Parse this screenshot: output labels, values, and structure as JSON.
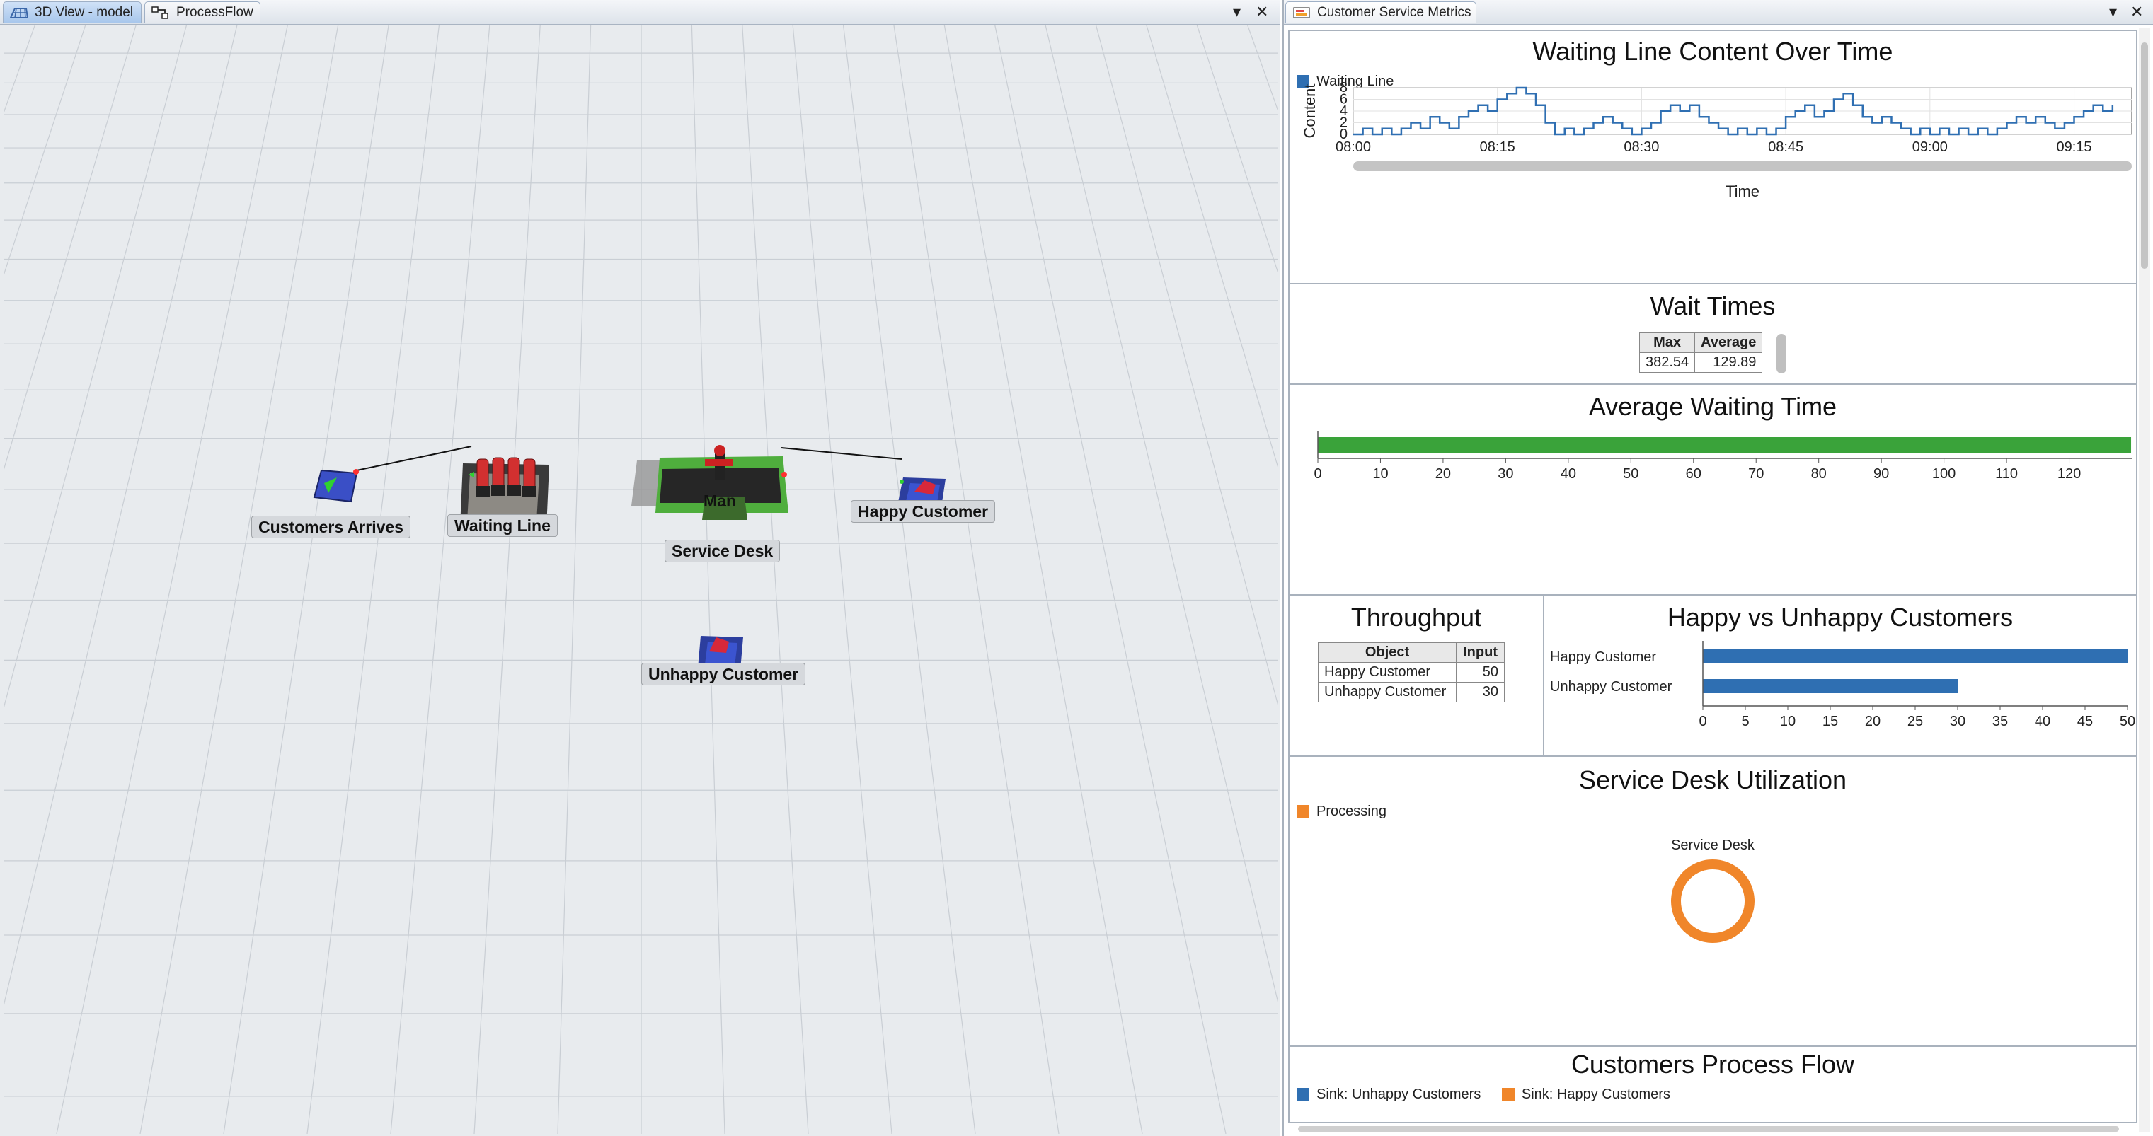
{
  "left_tabs": [
    {
      "label": "3D View - model",
      "active": true
    },
    {
      "label": "ProcessFlow",
      "active": false
    }
  ],
  "left_controls": {
    "menu": "▾",
    "close": "✕"
  },
  "model_objects": {
    "source": "Customers Arrives",
    "queue": "Waiting Line",
    "processor": "Service Desk",
    "operator": "Man",
    "sink_happy": "Happy Customer",
    "sink_unhappy": "Unhappy Customer"
  },
  "right_tab": {
    "label": "Customer Service Metrics"
  },
  "right_controls": {
    "menu": "▾",
    "close": "✕"
  },
  "colors": {
    "blue": "#2f6fb2",
    "green": "#3aa33a",
    "orange": "#f0862a"
  },
  "dashboard": {
    "waiting_line": {
      "title": "Waiting Line Content Over Time",
      "legend": "Waiting Line",
      "ylabel": "Content",
      "xlabel": "Time",
      "x_ticks": [
        "08:00",
        "08:15",
        "08:30",
        "08:45",
        "09:00",
        "09:15"
      ],
      "y_ticks": [
        "0",
        "2",
        "4",
        "6",
        "8"
      ]
    },
    "wait_times": {
      "title": "Wait Times",
      "headers": [
        "Max",
        "Average"
      ],
      "values": [
        "382.54",
        "129.89"
      ]
    },
    "avg_wait": {
      "title": "Average Waiting Time",
      "x_ticks": [
        "0",
        "10",
        "20",
        "30",
        "40",
        "50",
        "60",
        "70",
        "80",
        "90",
        "100",
        "110",
        "120"
      ]
    },
    "throughput": {
      "title": "Throughput",
      "headers": [
        "Object",
        "Input"
      ],
      "rows": [
        [
          "Happy Customer",
          "50"
        ],
        [
          "Unhappy Customer",
          "30"
        ]
      ]
    },
    "happy_unhappy": {
      "title": "Happy vs Unhappy Customers",
      "categories": [
        "Happy Customer",
        "Unhappy Customer"
      ],
      "x_ticks": [
        "0",
        "5",
        "10",
        "15",
        "20",
        "25",
        "30",
        "35",
        "40",
        "45",
        "50"
      ]
    },
    "utilization": {
      "title": "Service Desk Utilization",
      "legend": "Processing",
      "label": "Service Desk"
    },
    "process_flow": {
      "title": "Customers Process Flow",
      "legend": [
        "Sink: Unhappy Customers",
        "Sink: Happy Customers"
      ]
    }
  },
  "chart_data": [
    {
      "type": "line",
      "title": "Waiting Line Content Over Time",
      "xlabel": "Time",
      "ylabel": "Content",
      "ylim": [
        0,
        8
      ],
      "x_range": [
        "08:00",
        "09:19"
      ],
      "series": [
        {
          "name": "Waiting Line",
          "color": "#2f6fb2",
          "points": [
            [
              "08:00",
              0
            ],
            [
              "08:01",
              1
            ],
            [
              "08:02",
              0
            ],
            [
              "08:03",
              1
            ],
            [
              "08:04",
              0
            ],
            [
              "08:05",
              1
            ],
            [
              "08:06",
              2
            ],
            [
              "08:07",
              1
            ],
            [
              "08:08",
              3
            ],
            [
              "08:09",
              2
            ],
            [
              "08:10",
              1
            ],
            [
              "08:11",
              3
            ],
            [
              "08:12",
              4
            ],
            [
              "08:13",
              5
            ],
            [
              "08:14",
              4
            ],
            [
              "08:15",
              6
            ],
            [
              "08:16",
              7
            ],
            [
              "08:17",
              8
            ],
            [
              "08:18",
              7
            ],
            [
              "08:19",
              5
            ],
            [
              "08:20",
              2
            ],
            [
              "08:21",
              0
            ],
            [
              "08:22",
              1
            ],
            [
              "08:23",
              0
            ],
            [
              "08:24",
              1
            ],
            [
              "08:25",
              2
            ],
            [
              "08:26",
              3
            ],
            [
              "08:27",
              2
            ],
            [
              "08:28",
              1
            ],
            [
              "08:29",
              0
            ],
            [
              "08:30",
              1
            ],
            [
              "08:31",
              2
            ],
            [
              "08:32",
              4
            ],
            [
              "08:33",
              5
            ],
            [
              "08:34",
              4
            ],
            [
              "08:35",
              5
            ],
            [
              "08:36",
              3
            ],
            [
              "08:37",
              2
            ],
            [
              "08:38",
              1
            ],
            [
              "08:39",
              0
            ],
            [
              "08:40",
              1
            ],
            [
              "08:41",
              0
            ],
            [
              "08:42",
              1
            ],
            [
              "08:43",
              0
            ],
            [
              "08:44",
              1
            ],
            [
              "08:45",
              3
            ],
            [
              "08:46",
              4
            ],
            [
              "08:47",
              5
            ],
            [
              "08:48",
              3
            ],
            [
              "08:49",
              4
            ],
            [
              "08:50",
              6
            ],
            [
              "08:51",
              7
            ],
            [
              "08:52",
              5
            ],
            [
              "08:53",
              3
            ],
            [
              "08:54",
              2
            ],
            [
              "08:55",
              3
            ],
            [
              "08:56",
              2
            ],
            [
              "08:57",
              1
            ],
            [
              "08:58",
              0
            ],
            [
              "08:59",
              1
            ],
            [
              "09:00",
              0
            ],
            [
              "09:01",
              1
            ],
            [
              "09:02",
              0
            ],
            [
              "09:03",
              1
            ],
            [
              "09:04",
              0
            ],
            [
              "09:05",
              1
            ],
            [
              "09:06",
              0
            ],
            [
              "09:07",
              1
            ],
            [
              "09:08",
              2
            ],
            [
              "09:09",
              3
            ],
            [
              "09:10",
              2
            ],
            [
              "09:11",
              3
            ],
            [
              "09:12",
              2
            ],
            [
              "09:13",
              1
            ],
            [
              "09:14",
              2
            ],
            [
              "09:15",
              3
            ],
            [
              "09:16",
              4
            ],
            [
              "09:17",
              5
            ],
            [
              "09:18",
              4
            ],
            [
              "09:19",
              5
            ]
          ]
        }
      ]
    },
    {
      "type": "table",
      "title": "Wait Times",
      "columns": [
        "Max",
        "Average"
      ],
      "rows": [
        [
          382.54,
          129.89
        ]
      ]
    },
    {
      "type": "bar",
      "orientation": "horizontal",
      "title": "Average Waiting Time",
      "categories": [
        ""
      ],
      "values": [
        129.89
      ],
      "xlim": [
        0,
        130
      ],
      "color": "#3aa33a"
    },
    {
      "type": "table",
      "title": "Throughput",
      "columns": [
        "Object",
        "Input"
      ],
      "rows": [
        [
          "Happy Customer",
          50
        ],
        [
          "Unhappy Customer",
          30
        ]
      ]
    },
    {
      "type": "bar",
      "orientation": "horizontal",
      "title": "Happy vs Unhappy Customers",
      "categories": [
        "Happy Customer",
        "Unhappy Customer"
      ],
      "values": [
        50,
        30
      ],
      "xlim": [
        0,
        50
      ],
      "color": "#2f6fb2"
    },
    {
      "type": "pie",
      "title": "Service Desk Utilization",
      "categories": [
        "Processing"
      ],
      "values": [
        100
      ],
      "color": "#f0862a"
    }
  ]
}
